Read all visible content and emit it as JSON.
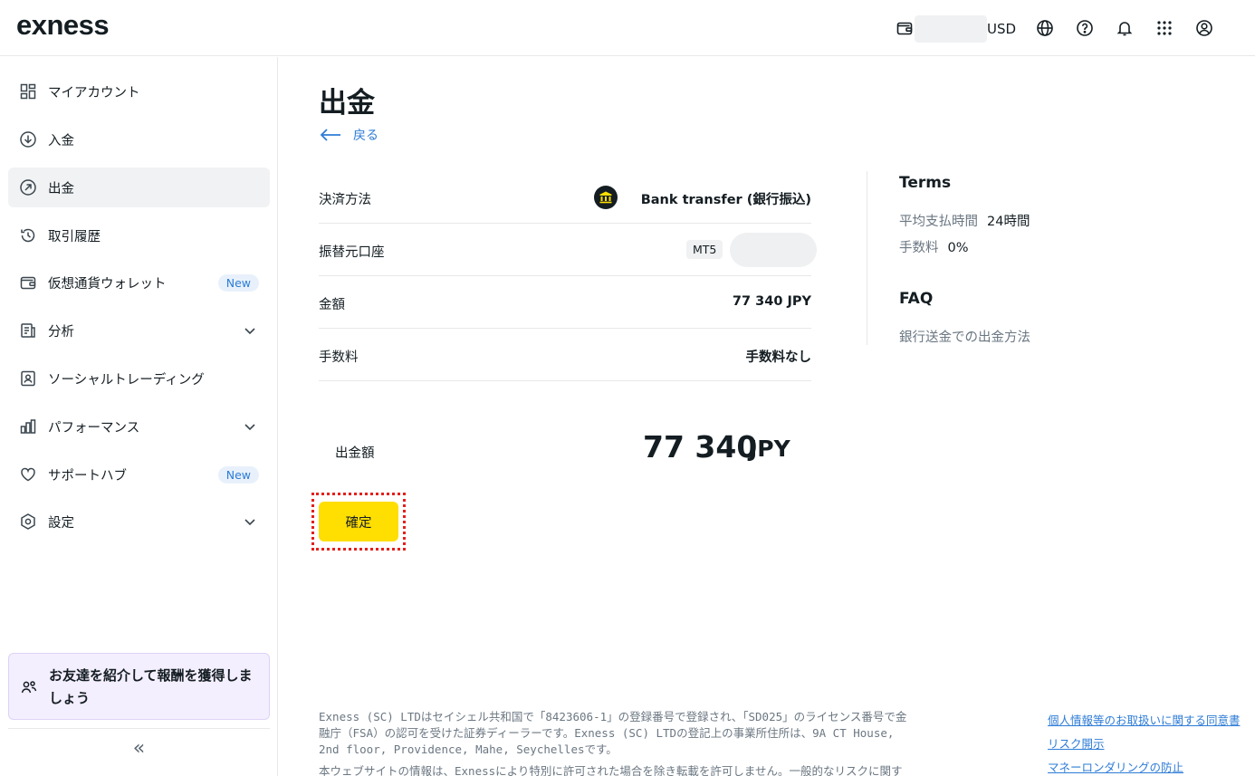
{
  "header": {
    "logo": "exness",
    "balance_currency": "USD",
    "icons": [
      "wallet-icon",
      "globe-icon",
      "help-icon",
      "bell-icon",
      "apps-grid-icon",
      "account-icon"
    ]
  },
  "sidebar": {
    "items": [
      {
        "label": "マイアカウント",
        "icon": "dashboard-icon"
      },
      {
        "label": "入金",
        "icon": "deposit-icon"
      },
      {
        "label": "出金",
        "icon": "withdraw-icon",
        "active": true
      },
      {
        "label": "取引履歴",
        "icon": "history-icon"
      },
      {
        "label": "仮想通貨ウォレット",
        "icon": "wallet-icon",
        "badge": "New"
      },
      {
        "label": "分析",
        "icon": "analytics-icon"
      },
      {
        "label": "ソーシャルトレーディング",
        "icon": "social-trading-icon"
      },
      {
        "label": "パフォーマンス",
        "icon": "performance-icon"
      },
      {
        "label": "サポートハブ",
        "icon": "heart-icon",
        "badge": "New"
      },
      {
        "label": "設定",
        "icon": "settings-icon"
      }
    ],
    "referral": "お友達を紹介して報酬を獲得しましょう",
    "collapse": "«"
  },
  "main": {
    "title": "出金",
    "back_label": "戻る",
    "rows": [
      {
        "label": "決済方法",
        "value": "Bank transfer (銀行振込)"
      },
      {
        "label": "振替元口座",
        "chip": "MT5"
      },
      {
        "label": "金額",
        "value": "77 340 JPY"
      },
      {
        "label": "手数料",
        "value": "手数料なし"
      }
    ],
    "total_label": "出金額",
    "total_amount": "77 340",
    "total_currency": "JPY",
    "confirm_label": "確定"
  },
  "terms": {
    "heading": "Terms",
    "avg_label": "平均支払時間",
    "avg_value": "24時間",
    "fee_label": "手数料",
    "fee_value": "0%",
    "faq_heading": "FAQ",
    "faq_link": "銀行送金での出金方法"
  },
  "footer": {
    "text": "Exness (SC) LTDはセイシェル共和国で「8423606-1」の登録番号で登録され、「SD025」のライセンス番号で金融庁（FSA）の認可を受けた証券ディーラーです。Exness (SC) LTDの登記上の事業所住所は、9A CT House, 2nd floor, Providence, Mahe, Seychellesです。",
    "text2": "本ウェブサイトの情報は、Exnessにより特別に許可された場合を除き転載を許可しません。一般的なリスクに関する警",
    "links": [
      "個人情報等のお取扱いに関する同意書",
      "リスク開示",
      "マネーロンダリングの防止"
    ]
  },
  "colors": {
    "accent_yellow": "#ffde02",
    "link_blue": "#2e7cd6",
    "highlight_red": "#e4201c"
  }
}
